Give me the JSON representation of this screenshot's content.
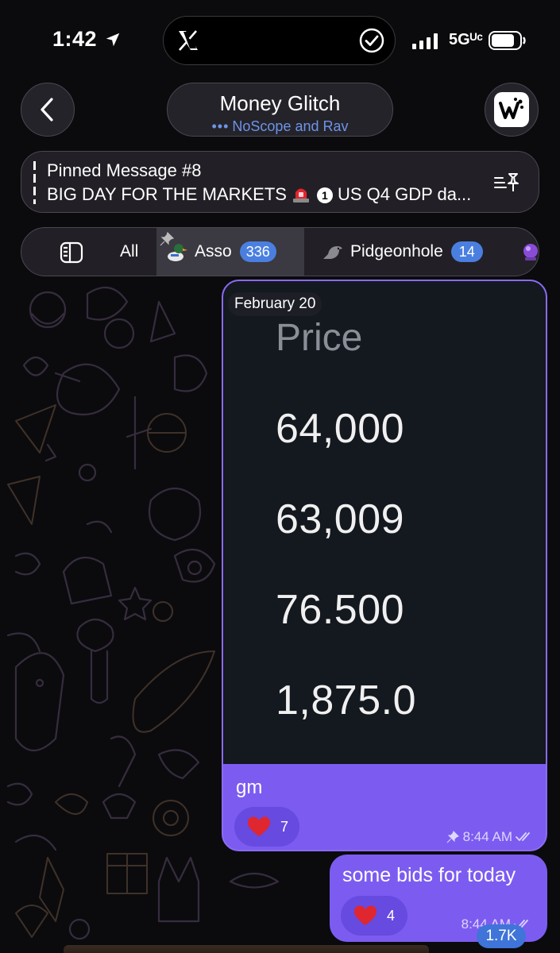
{
  "status_bar": {
    "time": "1:42",
    "network": "5Gᵁᶜ",
    "icons": [
      "location-arrow-icon",
      "x-logo-icon",
      "check-circle-icon",
      "signal-icon",
      "battery-icon"
    ]
  },
  "header": {
    "back_icon": "chevron-left-icon",
    "title": "Money Glitch",
    "typing_dots": "•••",
    "subtitle": "NoScope and Rav",
    "avatar_icon": "group-avatar-icon"
  },
  "pinned": {
    "title": "Pinned Message #8",
    "text_prefix": "BIG DAY FOR THE MARKETS",
    "emoji_one": "1",
    "text_suffix": "US Q4 GDP da...",
    "icons": [
      "siren-icon",
      "pin-list-icon"
    ]
  },
  "tabs": {
    "items": [
      {
        "label": "All"
      },
      {
        "label": "Asso",
        "count": "336",
        "icon": "duck-icon",
        "pinned": true
      },
      {
        "label": "Pidgeonhole",
        "count": "14",
        "icon": "pigeon-icon"
      }
    ]
  },
  "messages": [
    {
      "date_chip": "February 20",
      "photo": {
        "heading": "Price",
        "values": [
          "64,000",
          "63,009",
          "76.500",
          "1,875.0"
        ]
      },
      "text": "gm",
      "reaction": {
        "icon": "heart-icon",
        "count": "7"
      },
      "time": "8:44 AM"
    },
    {
      "text": "some bids for today",
      "reaction": {
        "icon": "heart-icon",
        "count": "4"
      },
      "time": "8:44 AM"
    }
  ],
  "views_badge": "1.7K",
  "colors": {
    "bubble": "#7c5cf0",
    "accent_blue": "#4a7fe0",
    "heart": "#e0262e",
    "background": "#0b0b0d"
  }
}
